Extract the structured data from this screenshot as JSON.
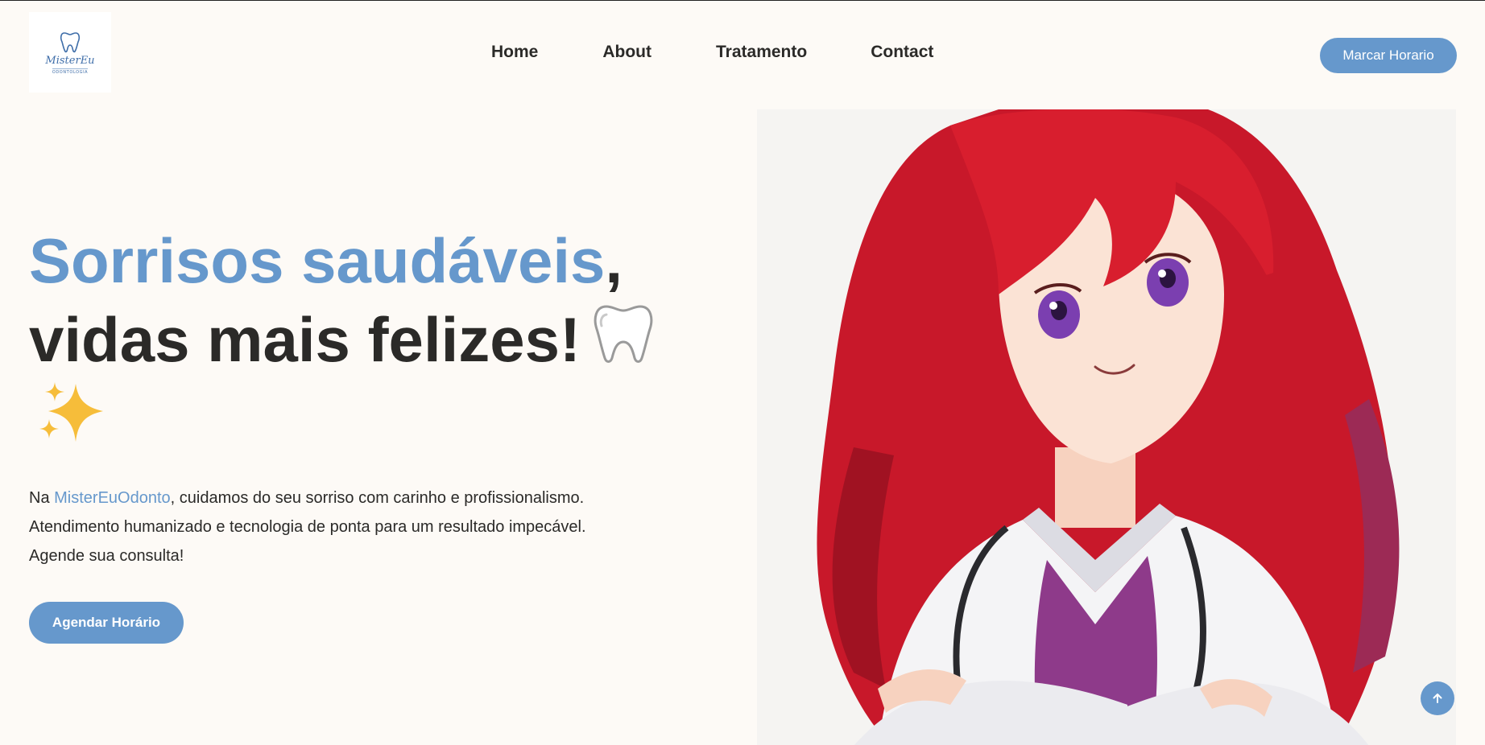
{
  "header": {
    "logo": {
      "script_text": "MisterEu",
      "sub_text": "ODONTOLOGIA",
      "icon": "tooth-logo-icon"
    },
    "nav": [
      "Home",
      "About",
      "Tratamento",
      "Contact"
    ],
    "cta_label": "Marcar Horario"
  },
  "hero": {
    "title_accent": "Sorrisos saudáveis",
    "title_comma": ",",
    "title_line2": "vidas mais felizes!",
    "title_emoji_icons": [
      "tooth-icon",
      "sparkles-icon"
    ],
    "text_prefix": "Na ",
    "text_brand": "MisterEuOdonto",
    "text_line1_rest": ", cuidamos do seu sorriso com carinho e profissionalismo.",
    "text_line2": "Atendimento humanizado e tecnologia de ponta para um resultado impecável.",
    "text_line3": "Agende sua consulta!",
    "button_label": "Agendar Horário",
    "image": "anime-doctor-illustration"
  },
  "scroll_top": {
    "icon": "arrow-up-icon"
  },
  "colors": {
    "accent": "#6698cc",
    "background": "#fdfaf6",
    "text": "#2b2a28",
    "sparkle": "#f6bd3a"
  }
}
